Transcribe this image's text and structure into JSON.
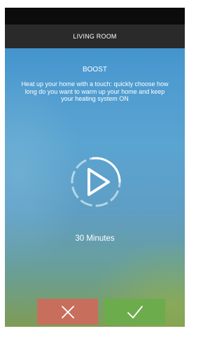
{
  "header": {
    "title": "LIVING ROOM"
  },
  "boost": {
    "title": "BOOST",
    "description": "Heat up your home with a touch: quickly choose how long do you want to warm up your home and keep your heating system ON",
    "duration_label": "30 Minutes"
  },
  "icons": {
    "play": "play-icon",
    "cancel": "close-icon",
    "confirm": "check-icon"
  },
  "colors": {
    "header_bg": "#2a2a2a",
    "cancel_bg": "#c76f5c",
    "confirm_bg": "#6dac4c"
  }
}
